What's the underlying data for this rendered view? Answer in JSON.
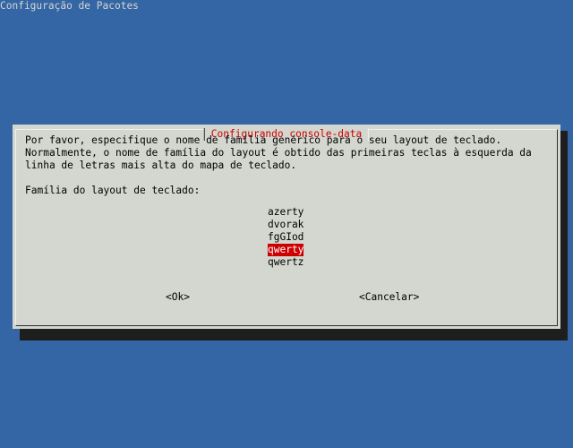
{
  "header": {
    "title": "Configuração de Pacotes"
  },
  "dialog": {
    "title": "Configurando console-data",
    "description": [
      "Por favor, especifique o nome de família genérico para o seu layout de teclado.",
      "Normalmente, o nome de família do layout é obtido das primeiras teclas à esquerda da",
      "linha de letras mais alta do mapa de teclado."
    ],
    "prompt": "Família do layout de teclado:",
    "options": [
      "azerty",
      "dvorak",
      "fgGIod",
      "qwerty",
      "qwertz"
    ],
    "selected": "qwerty",
    "buttons": {
      "ok": "<Ok>",
      "cancel": "<Cancelar>"
    }
  },
  "colors": {
    "background": "#3465a4",
    "dialog": "#d3d7cf",
    "title": "#cc0000",
    "selection": "#cc0000"
  }
}
